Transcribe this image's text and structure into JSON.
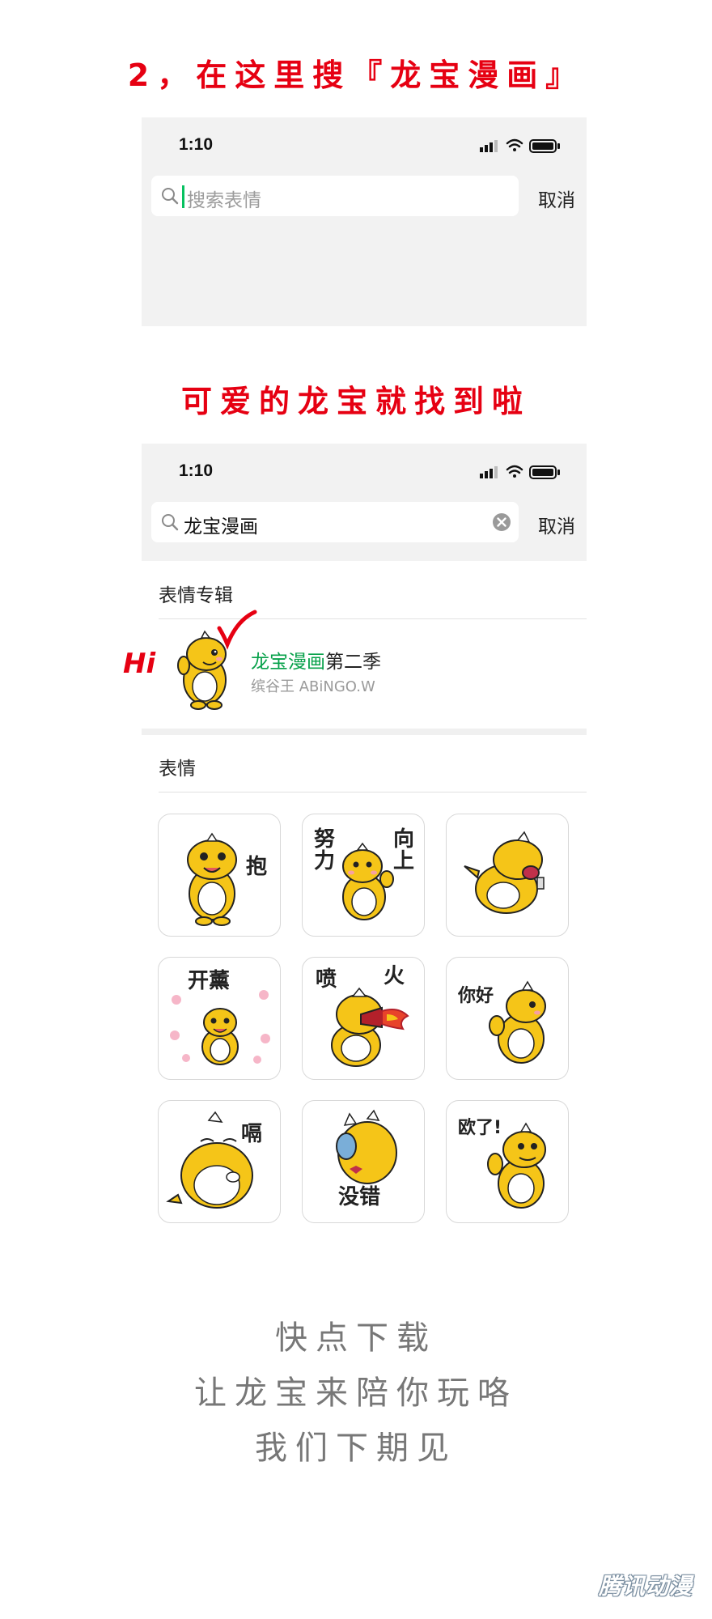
{
  "step1": {
    "heading": "2，在这里搜『龙宝漫画』",
    "phone": {
      "time": "1:10",
      "search_placeholder": "搜索表情",
      "cancel_label": "取消"
    }
  },
  "step2": {
    "heading": "可爱的龙宝就找到啦",
    "phone": {
      "time": "1:10",
      "search_value": "龙宝漫画",
      "cancel_label": "取消"
    },
    "album_section_title": "表情专辑",
    "album": {
      "name_highlight": "龙宝漫画",
      "name_rest": "第二季",
      "author": "缤谷王 ABiNGO.W",
      "hi_label": "Hi"
    },
    "stickers_section_title": "表情",
    "stickers": [
      {
        "caption": "抱"
      },
      {
        "caption_left": "努力",
        "caption_right": "向上"
      },
      {
        "caption": ""
      },
      {
        "caption": "开薰"
      },
      {
        "caption_left": "喷",
        "caption_right": "火"
      },
      {
        "caption": "你好"
      },
      {
        "caption": "嗝"
      },
      {
        "caption": "没错"
      },
      {
        "caption": "欧了!"
      }
    ]
  },
  "closing": {
    "line1": "快点下载",
    "line2": "让龙宝来陪你玩咯",
    "line3": "我们下期见"
  },
  "watermark": "腾讯动漫",
  "colors": {
    "accent_red": "#e60012",
    "wechat_green": "#07c160",
    "dragon_yellow": "#f5c518"
  }
}
